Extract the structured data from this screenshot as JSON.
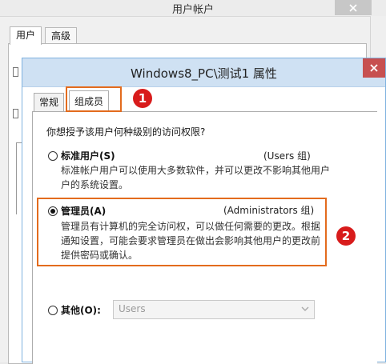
{
  "back_window": {
    "title": "用户帐户",
    "tabs": [
      {
        "label": "用户"
      },
      {
        "label": "高级"
      }
    ]
  },
  "dialog": {
    "title": "Windows8_PC\\测试1 属性",
    "tabs": [
      {
        "label": "常规"
      },
      {
        "label": "组成员"
      }
    ],
    "question": "你想授予该用户何种级别的访问权限?",
    "options": {
      "standard": {
        "label": "标准用户(S)",
        "group": "(Users 组)",
        "desc_line1": "标准帐户用户可以使用大多数软件，并可以更改不影响其他用户",
        "desc_line2": "户的系统设置。",
        "selected": false
      },
      "admin": {
        "label": "管理员(A)",
        "group": "(Administrators 组)",
        "desc_line1": "管理员有计算机的完全访问权，可以做任何需要的更改。根据",
        "desc_line2": "通知设置，可能会要求管理员在做出会影响其他用户的更改前",
        "desc_line3": "提供密码或确认。",
        "selected": true
      },
      "other": {
        "label": "其他(O):",
        "select_value": "Users",
        "selected": false
      }
    }
  },
  "annotations": {
    "badge1": "1",
    "badge2": "2"
  },
  "colors": {
    "highlight": "#e36b1d",
    "badge": "#d81c1c",
    "title_bar": "#cfe1f3",
    "close_button": "#c75050"
  },
  "icons": [
    "close-icon",
    "dropdown-arrow-icon"
  ]
}
